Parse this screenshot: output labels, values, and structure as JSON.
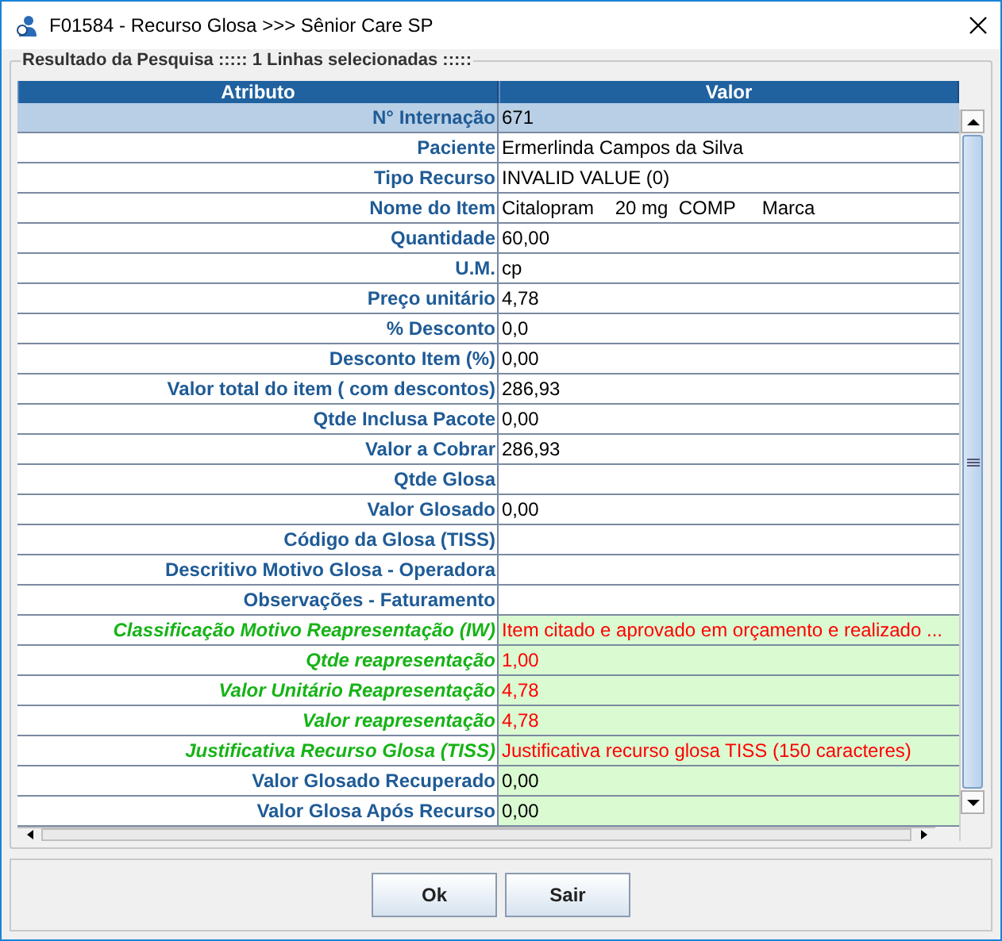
{
  "window": {
    "title": "F01584 - Recurso Glosa >>> Sênior Care SP"
  },
  "group_title": "Resultado da Pesquisa ::::: 1 Linhas selecionadas :::::",
  "table": {
    "columns": [
      "Atributo",
      "Valor"
    ],
    "rows": [
      {
        "kind": "info",
        "label": "N° Internação",
        "value": "671",
        "selected": true,
        "color": "#000000"
      },
      {
        "kind": "info",
        "label": "Paciente",
        "value": "Ermerlinda Campos da Silva",
        "selected": false,
        "color": "#000000"
      },
      {
        "kind": "info",
        "label": "Tipo Recurso",
        "value": "INVALID VALUE (0)",
        "selected": false,
        "color": "#000000"
      },
      {
        "kind": "info",
        "label": "Nome do Item",
        "value": "Citalopram    20 mg  COMP     Marca",
        "selected": false,
        "color": "#000000"
      },
      {
        "kind": "info",
        "label": "Quantidade",
        "value": "60,00",
        "selected": false,
        "color": "#000000"
      },
      {
        "kind": "info",
        "label": "U.M.",
        "value": "cp",
        "selected": false,
        "color": "#000000"
      },
      {
        "kind": "info",
        "label": "Preço unitário",
        "value": "4,78",
        "selected": false,
        "color": "#000000"
      },
      {
        "kind": "info",
        "label": "% Desconto",
        "value": "0,0",
        "selected": false,
        "color": "#000000"
      },
      {
        "kind": "info",
        "label": "Desconto Item (%)",
        "value": "0,00",
        "selected": false,
        "color": "#000000"
      },
      {
        "kind": "info",
        "label": "Valor total do item ( com descontos)",
        "value": "286,93",
        "selected": false,
        "color": "#000000"
      },
      {
        "kind": "info",
        "label": "Qtde Inclusa Pacote",
        "value": "0,00",
        "selected": false,
        "color": "#000000"
      },
      {
        "kind": "info",
        "label": "Valor a Cobrar",
        "value": "286,93",
        "selected": false,
        "color": "#000000"
      },
      {
        "kind": "info",
        "label": "Qtde Glosa",
        "selected": false
      },
      {
        "kind": "info",
        "label": "Valor Glosado",
        "value": "0,00",
        "selected": false,
        "color": "#000000"
      },
      {
        "kind": "info",
        "label": "Código da Glosa (TISS)",
        "selected": false
      },
      {
        "kind": "info",
        "label": "Descritivo Motivo Glosa - Operadora",
        "selected": false
      },
      {
        "kind": "info",
        "label": "Observações - Faturamento",
        "selected": false
      },
      {
        "kind": "edit",
        "label": "Classificação Motivo Reapresentação (IW)",
        "value": "Item citado e aprovado em orçamento e realizado ...",
        "selected": false,
        "color": "#ff0000"
      },
      {
        "kind": "edit",
        "label": "Qtde reapresentação",
        "value": "1,00",
        "selected": false,
        "color": "#ff0000"
      },
      {
        "kind": "edit",
        "label": "Valor Unitário Reapresentação",
        "value": "4,78",
        "selected": false,
        "color": "#ff0000"
      },
      {
        "kind": "edit",
        "label": "Valor reapresentação",
        "value": "4,78",
        "selected": false,
        "color": "#ff0000"
      },
      {
        "kind": "edit",
        "label": "Justificativa Recurso Glosa (TISS)",
        "value": "Justificativa recurso glosa TISS (150 caracteres)",
        "selected": false,
        "color": "#ff0000"
      },
      {
        "kind": "result",
        "label": "Valor Glosado Recuperado",
        "value": "0,00",
        "selected": false,
        "color": "#000000"
      },
      {
        "kind": "result",
        "label": "Valor Glosa Após Recurso",
        "value": "0,00",
        "selected": false,
        "color": "#000000"
      }
    ]
  },
  "buttons": [
    "Ok",
    "Sair"
  ]
}
